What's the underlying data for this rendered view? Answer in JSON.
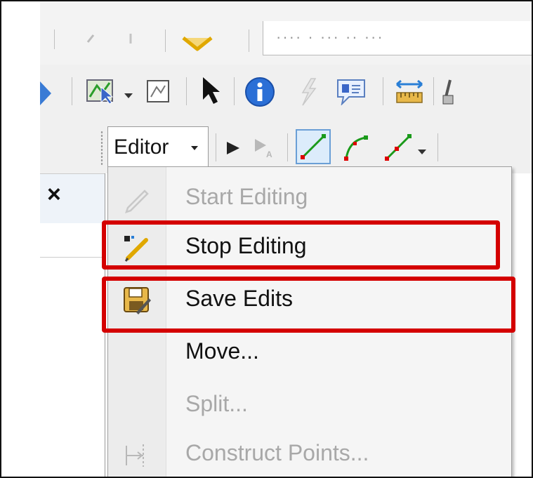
{
  "toolbar": {
    "scale_text": "···· · ··· ·· ···",
    "editor_label": "Editor"
  },
  "menu": {
    "items": [
      {
        "label": "Start Editing",
        "enabled": false,
        "icon": "pencil-icon"
      },
      {
        "label": "Stop Editing",
        "enabled": true,
        "icon": "stop-editing-icon",
        "highlighted": true
      },
      {
        "label": "Save Edits",
        "enabled": true,
        "icon": "save-edits-icon",
        "highlighted": true
      },
      {
        "label": "Move...",
        "enabled": true,
        "icon": ""
      },
      {
        "label": "Split...",
        "enabled": false,
        "icon": ""
      },
      {
        "label": "Construct Points...",
        "enabled": false,
        "icon": "construct-points-icon"
      }
    ]
  },
  "panel": {
    "close_glyph": "×"
  },
  "colors": {
    "highlight": "#d40000",
    "disabled_text": "#a8a8a8"
  }
}
